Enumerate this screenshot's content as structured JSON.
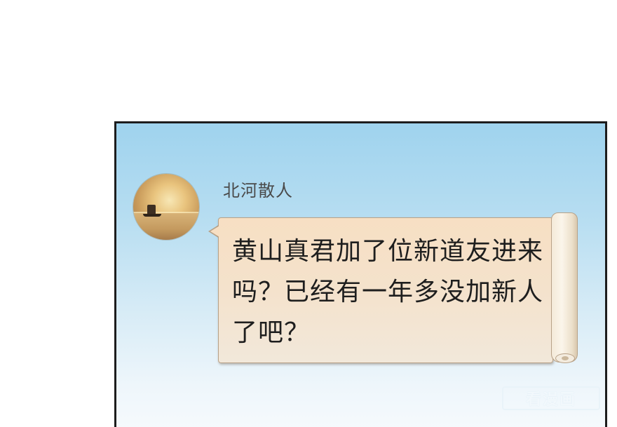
{
  "post": {
    "username": "北河散人",
    "message_lines": [
      "黄山真君加了位新道友进来",
      "吗？已经有一年多没加新人",
      "了吧？"
    ]
  },
  "watermark": {
    "text": "看漫画"
  },
  "colors": {
    "panel_border": "#1d1d1d",
    "sky_top": "#9fd3ee",
    "bubble_fill": "#f7dfc3",
    "bubble_border": "#b8a288",
    "username_text": "#4a4a4a"
  },
  "icons": {
    "avatar": "sunset-boat-avatar",
    "scroll": "paper-scroll-roll"
  }
}
